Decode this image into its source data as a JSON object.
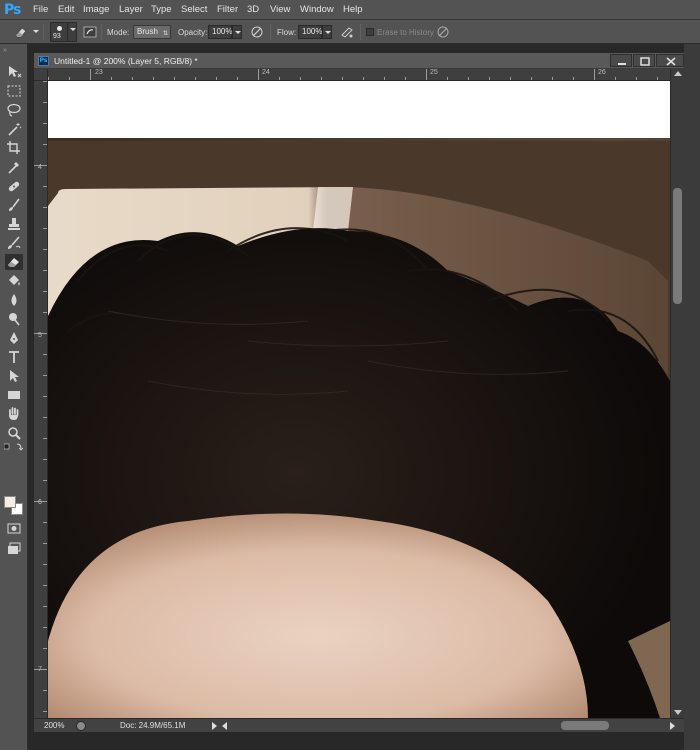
{
  "app": {
    "logo": "Ps",
    "menu": [
      "File",
      "Edit",
      "Image",
      "Layer",
      "Type",
      "Select",
      "Filter",
      "3D",
      "View",
      "Window",
      "Help"
    ]
  },
  "options": {
    "brush_size": "93",
    "mode_label": "Mode:",
    "mode_value": "Brush",
    "opacity_label": "Opacity:",
    "opacity_value": "100%",
    "flow_label": "Flow:",
    "flow_value": "100%",
    "erase_history_label": "Erase to History"
  },
  "toolbar": {
    "grip": "»",
    "tools": [
      "move-tool-icon",
      "marquee-tool-icon",
      "lasso-tool-icon",
      "magic-wand-icon",
      "crop-tool-icon",
      "eyedropper-icon",
      "healing-brush-icon",
      "brush-tool-icon",
      "clone-stamp-icon",
      "history-brush-icon",
      "eraser-tool-icon",
      "paint-bucket-icon",
      "blur-tool-icon",
      "dodge-tool-icon",
      "pen-tool-icon",
      "type-tool-icon",
      "path-selection-icon",
      "rectangle-tool-icon",
      "hand-tool-icon",
      "zoom-tool-icon"
    ],
    "active_tool": "eraser-tool-icon",
    "foreground_color": "#f5eee6",
    "background_color": "#ffffff"
  },
  "document": {
    "ps_badge": "Ps",
    "title": "Untitled-1 @ 200% (Layer 5, RGB/8) *",
    "ruler_top": [
      "23",
      "24",
      "25",
      "26"
    ],
    "ruler_left": [
      "4",
      "5",
      "6",
      "7"
    ]
  },
  "status": {
    "zoom": "200%",
    "doc_size": "Doc: 24.9M/65.1M"
  }
}
